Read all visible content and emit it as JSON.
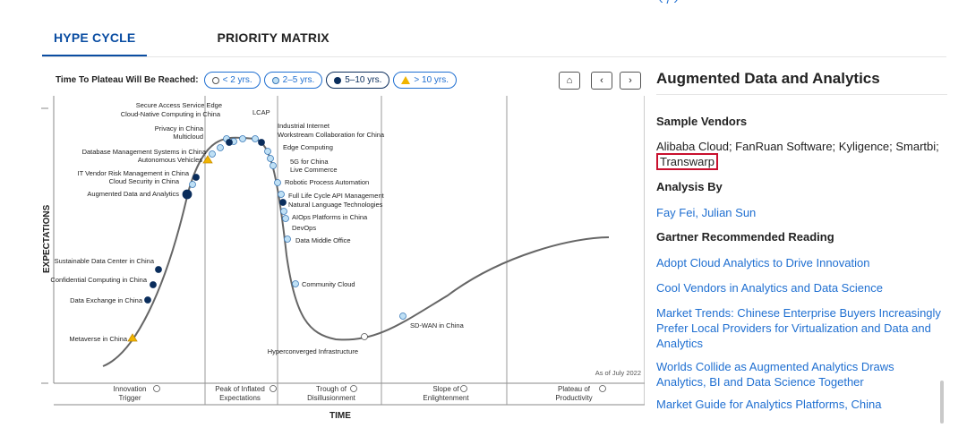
{
  "tabs": [
    {
      "label": "HYPE CYCLE",
      "active": true
    },
    {
      "label": "PRIORITY MATRIX",
      "active": false
    }
  ],
  "filters": {
    "label": "Time To Plateau Will Be Reached:",
    "options": [
      "< 2 yrs.",
      "2–5 yrs.",
      "5–10 yrs.",
      "> 10 yrs."
    ]
  },
  "nav": {
    "home": "⌂",
    "prev": "‹",
    "next": "›"
  },
  "chart": {
    "ylabel": "EXPECTATIONS",
    "xlabel": "TIME",
    "as_of": "As of July 2022",
    "phases": [
      [
        "Innovation",
        "Trigger"
      ],
      [
        "Peak of Inflated",
        "Expectations"
      ],
      [
        "Trough of",
        "Disillusionment"
      ],
      [
        "Slope of",
        "Enlightenment"
      ],
      [
        "Plateau of",
        "Productivity"
      ]
    ],
    "points": [
      {
        "label": "Secure Access Service Edge",
        "cat": "light"
      },
      {
        "label": "Cloud-Native Computing in China",
        "cat": "light"
      },
      {
        "label": "LCAP",
        "cat": "light"
      },
      {
        "label": "Privacy in China",
        "cat": "navy"
      },
      {
        "label": "Multicloud",
        "cat": "light"
      },
      {
        "label": "Industrial Internet",
        "cat": "light"
      },
      {
        "label": "Workstream Collaboration for China",
        "cat": "navy"
      },
      {
        "label": "Database Management Systems in China",
        "cat": "light"
      },
      {
        "label": "Autonomous Vehicles",
        "cat": "tri"
      },
      {
        "label": "Edge Computing",
        "cat": "light"
      },
      {
        "label": "5G for China",
        "cat": "light"
      },
      {
        "label": "Live Commerce",
        "cat": "light"
      },
      {
        "label": "IT Vendor Risk Management in China",
        "cat": "navy"
      },
      {
        "label": "Cloud Security in China",
        "cat": "light"
      },
      {
        "label": "Robotic Process Automation",
        "cat": "light"
      },
      {
        "label": "Augmented Data and Analytics",
        "cat": "navy"
      },
      {
        "label": "Full Life Cycle API Management",
        "cat": "light"
      },
      {
        "label": "Natural Language Technologies",
        "cat": "navy"
      },
      {
        "label": "AIOps Platforms in China",
        "cat": "light"
      },
      {
        "label": "DevOps",
        "cat": "light"
      },
      {
        "label": "Data Middle Office",
        "cat": "light"
      },
      {
        "label": "Sustainable Data Center in China",
        "cat": "navy"
      },
      {
        "label": "Confidential Computing in China",
        "cat": "navy"
      },
      {
        "label": "Community Cloud",
        "cat": "light"
      },
      {
        "label": "Data Exchange in China",
        "cat": "navy"
      },
      {
        "label": "SD-WAN in China",
        "cat": "light"
      },
      {
        "label": "Metaverse in China",
        "cat": "tri"
      },
      {
        "label": "Hyperconverged Infrastructure",
        "cat": "white"
      }
    ]
  },
  "panel": {
    "title": "Augmented Data and Analytics",
    "vendors_heading": "Sample Vendors",
    "vendors_text": "Alibaba Cloud; FanRuan Software; Kyligence; Smartbi;",
    "vendors_highlight": "Transwarp",
    "analysis_heading": "Analysis By",
    "analysts": "Fay Fei, Julian Sun",
    "reading_heading": "Gartner Recommended Reading",
    "links": [
      "Adopt Cloud Analytics to Drive Innovation",
      "Cool Vendors in Analytics and Data Science",
      "Market Trends: Chinese Enterprise Buyers Increasingly Prefer Local Providers for Virtualization and Data and Analytics",
      "Worlds Collide as Augmented Analytics Draws Analytics, BI and Data Science Together",
      "Market Guide for Analytics Platforms, China"
    ]
  },
  "colors": {
    "accent": "#0a4da2",
    "link": "#1f6fd1",
    "navy": "#0a2d5c",
    "light": "#bfe0f5",
    "highlight": "#c8102e",
    "warning": "#f0b400"
  }
}
